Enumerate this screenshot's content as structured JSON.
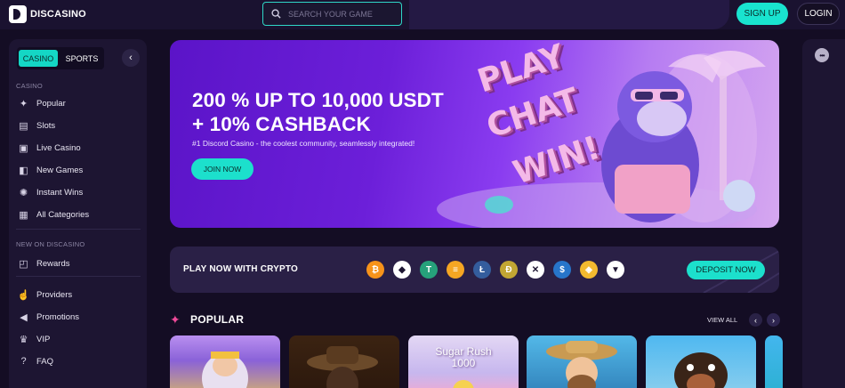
{
  "header": {
    "logo_text": "DISCASINO",
    "search_placeholder": "SEARCH YOUR GAME",
    "signup_label": "SIGN UP",
    "login_label": "LOGIN"
  },
  "sidebar": {
    "tabs": [
      "CASINO",
      "SPORTS"
    ],
    "collapse_icon": "chevron-left-icon",
    "section_casino": "CASINO",
    "casino_items": [
      {
        "label": "Popular",
        "icon": "sparkle-icon"
      },
      {
        "label": "Slots",
        "icon": "slots-icon"
      },
      {
        "label": "Live Casino",
        "icon": "live-casino-icon"
      },
      {
        "label": "New Games",
        "icon": "new-games-icon"
      },
      {
        "label": "Instant Wins",
        "icon": "instant-wins-icon"
      },
      {
        "label": "All Categories",
        "icon": "grid-icon"
      }
    ],
    "section_new": "NEW ON DISCASINO",
    "new_items": [
      {
        "label": "Rewards",
        "icon": "gift-icon"
      }
    ],
    "other_items": [
      {
        "label": "Providers",
        "icon": "providers-icon"
      },
      {
        "label": "Promotions",
        "icon": "megaphone-icon"
      },
      {
        "label": "VIP",
        "icon": "crown-icon"
      },
      {
        "label": "FAQ",
        "icon": "question-icon"
      }
    ]
  },
  "banner": {
    "headline_1": "200 % UP TO 10,000 USDT",
    "headline_2": "+ 10% CASHBACK",
    "subtitle": "#1 Discord Casino - the coolest community, seamlessly integrated!",
    "join_label": "JOIN NOW",
    "art_words": [
      "PLAY",
      "CHAT",
      "WIN!"
    ]
  },
  "crypto": {
    "label": "PLAY NOW WITH CRYPTO",
    "coins": [
      {
        "name": "bitcoin-icon",
        "glyph": "₿",
        "color": "#f7931a"
      },
      {
        "name": "ethereum-icon",
        "glyph": "◆",
        "color": "#ffffff"
      },
      {
        "name": "tether-icon",
        "glyph": "T",
        "color": "#26a17b"
      },
      {
        "name": "bch-icon",
        "glyph": "≡",
        "color": "#f5a623"
      },
      {
        "name": "litecoin-icon",
        "glyph": "Ł",
        "color": "#345d9d"
      },
      {
        "name": "dogecoin-icon",
        "glyph": "Ð",
        "color": "#c2a633"
      },
      {
        "name": "xrp-icon",
        "glyph": "✕",
        "color": "#ffffff"
      },
      {
        "name": "usdc-icon",
        "glyph": "$",
        "color": "#2775ca"
      },
      {
        "name": "bnb-icon",
        "glyph": "◈",
        "color": "#f3ba2f"
      },
      {
        "name": "tron-icon",
        "glyph": "▼",
        "color": "#ffffff"
      }
    ],
    "deposit_label": "DEPOSIT NOW"
  },
  "popular": {
    "title": "POPULAR",
    "view_all": "VIEW ALL",
    "games": [
      {
        "name": "game-zeus",
        "label": ""
      },
      {
        "name": "game-cowboy",
        "label": ""
      },
      {
        "name": "game-sugar-rush",
        "label": "Sugar Rush\n1000"
      },
      {
        "name": "game-fisherman",
        "label": ""
      },
      {
        "name": "game-dog",
        "label": ""
      }
    ]
  }
}
